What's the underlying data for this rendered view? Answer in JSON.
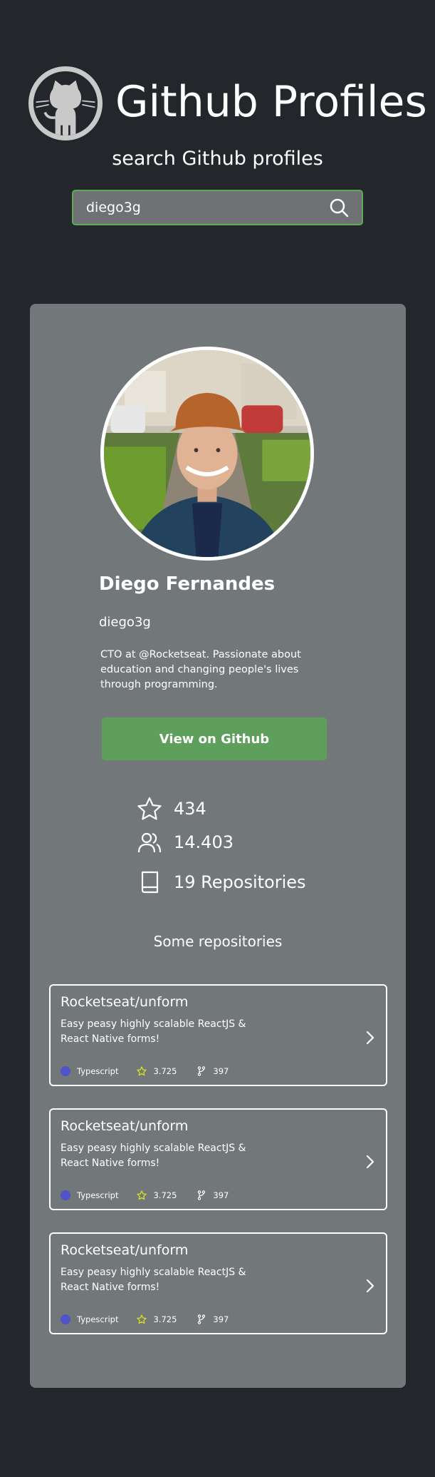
{
  "header": {
    "title": "Github Profiles",
    "subtitle": "search  Github profiles"
  },
  "search": {
    "value": "diego3g"
  },
  "profile": {
    "name": "Diego Fernandes",
    "username": "diego3g",
    "bio": "CTO at @Rocketseat. Passionate about education and changing people's lives through programming.",
    "button_label": "View on Github",
    "stars": "434",
    "followers": "14.403",
    "repositories": "19 Repositories"
  },
  "repos_section": {
    "title": "Some repositories",
    "items": [
      {
        "name": "Rocketseat/unform",
        "description": "Easy peasy highly scalable ReactJS & React Native forms!",
        "language": "Typescript",
        "stars": "3.725",
        "forks": "397"
      },
      {
        "name": "Rocketseat/unform",
        "description": "Easy peasy highly scalable ReactJS & React Native forms!",
        "language": "Typescript",
        "stars": "3.725",
        "forks": "397"
      },
      {
        "name": "Rocketseat/unform",
        "description": "Easy peasy highly scalable ReactJS & React Native forms!",
        "language": "Typescript",
        "stars": "3.725",
        "forks": "397"
      }
    ]
  },
  "colors": {
    "background": "#23272b",
    "card": "#72777a",
    "accent_green": "#5ea05b",
    "language_dot": "#4f55c9",
    "star_yellow": "#d9e021"
  },
  "icons": {
    "logo": "github-octocat-icon",
    "search": "search-icon",
    "stars": "star-icon",
    "followers": "users-icon",
    "repositories": "book-icon",
    "chevron": "chevron-right-icon",
    "fork": "git-fork-icon"
  }
}
